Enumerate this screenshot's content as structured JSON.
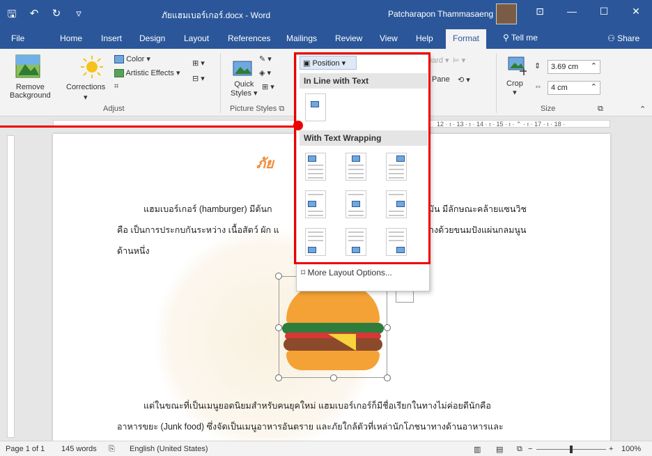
{
  "titlebar": {
    "doc_title": "ภัยแฮมเบอร์เกอร์.docx - Word",
    "user_name": "Patcharapon Thammasaeng",
    "qat": {
      "save": "🖫",
      "undo": "↶",
      "undo_arrow": "·",
      "redo": "↻",
      "customize": "▿"
    },
    "controls": {
      "ribbon_display": "⊡",
      "minimize": "—",
      "maximize": "☐",
      "close": "✕"
    }
  },
  "tabs": {
    "items": [
      "File",
      "Home",
      "Insert",
      "Design",
      "Layout",
      "References",
      "Mailings",
      "Review",
      "View",
      "Help",
      "Format"
    ],
    "active": "Format",
    "tell_me": "Tell me",
    "share": "Share"
  },
  "ribbon": {
    "remove_background": "Remove Background",
    "remove_background_l1": "Remove",
    "remove_background_l2": "Background",
    "corrections": "Corrections",
    "color": "Color",
    "artistic_effects": "Artistic Effects",
    "adjust_label": "Adjust",
    "quick_styles_l1": "Quick",
    "quick_styles_l2": "Styles",
    "picture_styles_label": "Picture Styles",
    "position": "Position",
    "send_backward": "Send Backward",
    "selection_pane": "Pane",
    "crop": "Crop",
    "height": "3.69 cm",
    "width": "4 cm",
    "size_label": "Size"
  },
  "ruler": {
    "ticks": "12 · ı · 13 · ı · 14 · ı · 15 · ı · ⌃ · ı · 17 · ı · 18 ·"
  },
  "position_menu": {
    "inline_header": "In Line with Text",
    "wrapping_header": "With Text Wrapping",
    "more_options": "More Layout Options..."
  },
  "document": {
    "heading": "ภัย",
    "p1_line1_left": "แฮมเบอร์เกอร์ (hamburger) มีต้นก",
    "p1_line1_right": "รมัน มีลักษณะคล้ายแซนวิช",
    "p1_line2_left": "คือ เป็นการประกบกันระหว่าง เนื้อสัตว์ ผัก แ",
    "p1_line2_right": "างด้วยขนมปังแผ่นกลมนูน",
    "p1_line3": "ด้านหนึ่ง",
    "p2_line1": "แต่ในขณะที่เป็นเมนูยอดนิยมสำหรับคนยุคใหม่  แฮมเบอร์เกอร์ก็มีชื่อเรียกในทางไม่ค่อยดีนักคือ",
    "p2_line2": "อาหารขยะ (Junk food) ซึ่งจัดเป็นเมนูอาหารอันตราย และภัยใกล้ตัวที่เหล่านักโภชนาทางด้านอาหารและ"
  },
  "status": {
    "page": "Page 1 of 1",
    "words": "145 words",
    "language": "English (United States)",
    "zoom": "100%",
    "zoom_minus": "−",
    "zoom_plus": "+"
  },
  "colors": {
    "brand": "#2b579a",
    "highlight": "#e00000",
    "heading": "#f08c3a"
  }
}
